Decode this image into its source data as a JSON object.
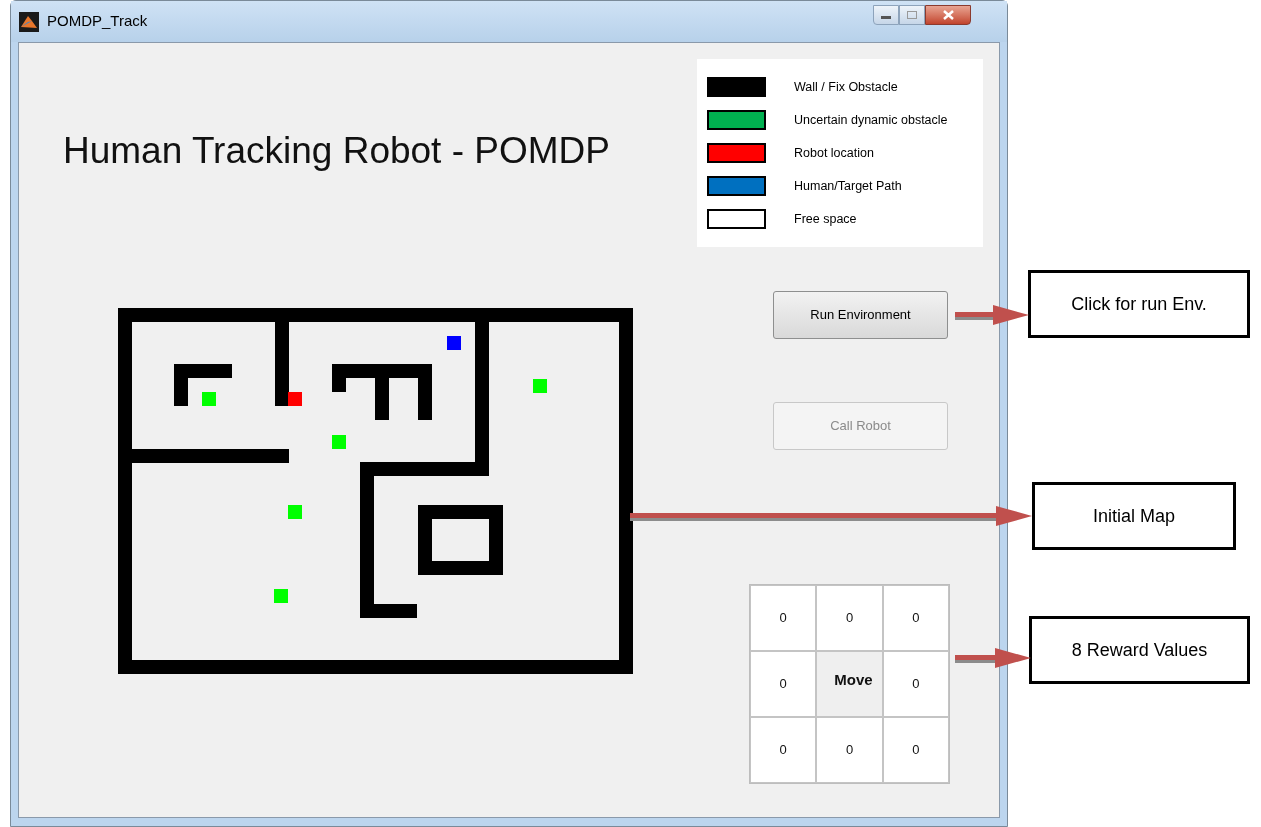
{
  "window": {
    "title": "POMDP_Track"
  },
  "heading": "Human Tracking Robot - POMDP",
  "legend": [
    {
      "label": "Wall / Fix Obstacle",
      "color": "#000000"
    },
    {
      "label": "Uncertain dynamic obstacle",
      "color": "#00b050"
    },
    {
      "label": "Robot location",
      "color": "#ff0000"
    },
    {
      "label": "Human/Target Path",
      "color": "#0070c0"
    },
    {
      "label": "Free space",
      "color": "#ffffff"
    }
  ],
  "buttons": [
    {
      "label": "Run Environment",
      "disabled": false
    },
    {
      "label": "Call Robot",
      "disabled": true
    }
  ],
  "reward_grid": {
    "rows": [
      [
        {
          "kind": "value",
          "text": "0"
        },
        {
          "kind": "value",
          "text": "0"
        },
        {
          "kind": "value",
          "text": "0"
        }
      ],
      [
        {
          "kind": "value",
          "text": "0"
        },
        {
          "kind": "button",
          "text": "Move"
        },
        {
          "kind": "value",
          "text": "0"
        }
      ],
      [
        {
          "kind": "value",
          "text": "0"
        },
        {
          "kind": "value",
          "text": "0"
        },
        {
          "kind": "value",
          "text": "0"
        }
      ]
    ]
  },
  "annotations": [
    {
      "text": "Click for run Env."
    },
    {
      "text": "Initial Map"
    },
    {
      "text": "8 Reward Values"
    }
  ]
}
